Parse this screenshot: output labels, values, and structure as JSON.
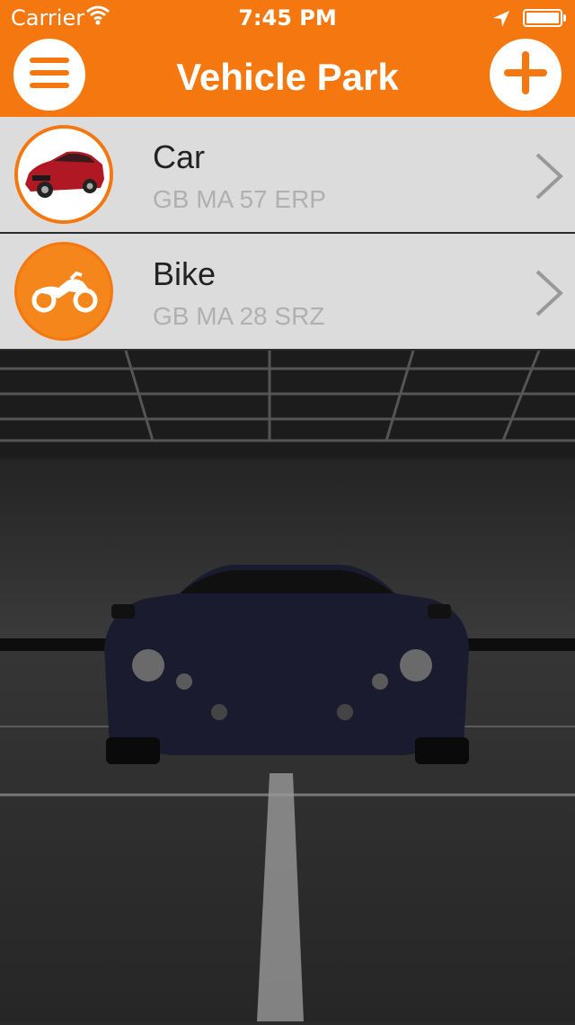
{
  "status_bar": {
    "carrier": "Carrier",
    "time": "7:45 PM",
    "wifi_icon": "wifi-icon",
    "location_icon": "location-arrow-icon",
    "battery_icon": "battery-icon"
  },
  "nav": {
    "title": "Vehicle Park",
    "menu_icon": "hamburger-menu-icon",
    "add_icon": "plus-icon"
  },
  "vehicles": [
    {
      "name": "Car",
      "plate": "GB MA 57 ERP",
      "thumb_icon": "car-photo"
    },
    {
      "name": "Bike",
      "plate": "GB MA 28 SRZ",
      "thumb_icon": "motorcycle-icon"
    }
  ],
  "colors": {
    "accent": "#f5770f",
    "row_background": "#dcdcdc",
    "plate_text": "#b0b0b0"
  }
}
